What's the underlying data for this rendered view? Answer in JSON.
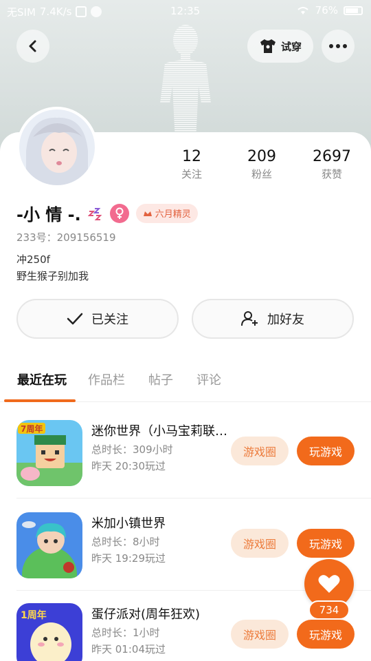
{
  "status_bar": {
    "carrier": "无SIM",
    "speed": "7.4K/s",
    "time": "12:35",
    "battery": "76%"
  },
  "header": {
    "try_on_label": "试穿"
  },
  "profile": {
    "stats": [
      {
        "value": "12",
        "label": "关注"
      },
      {
        "value": "209",
        "label": "粉丝"
      },
      {
        "value": "2697",
        "label": "获赞"
      }
    ],
    "name": "-小 情 -.",
    "badge_label": "六月精灵",
    "id_text": "233号：209156519",
    "bio_lines": [
      "冲250f",
      "野生猴子别加我"
    ]
  },
  "actions": {
    "followed_label": "已关注",
    "add_friend_label": "加好友"
  },
  "tabs": [
    {
      "label": "最近在玩"
    },
    {
      "label": "作品栏"
    },
    {
      "label": "帖子"
    },
    {
      "label": "评论"
    }
  ],
  "games": [
    {
      "title": "迷你世界（小马宝莉联…",
      "duration": "总时长：309小时",
      "last_played": "昨天 20:30玩过",
      "icon_text": "7周年",
      "circle_label": "游戏圈",
      "play_label": "玩游戏"
    },
    {
      "title": "米加小镇世界",
      "duration": "总时长：8小时",
      "last_played": "昨天 19:29玩过",
      "icon_text": "",
      "circle_label": "游戏圈",
      "play_label": "玩游戏"
    },
    {
      "title": "蛋仔派对(周年狂欢)",
      "duration": "总时长：1小时",
      "last_played": "昨天 01:04玩过",
      "icon_text": "1周年",
      "circle_label": "游戏圈",
      "play_label": "玩游戏"
    }
  ],
  "like": {
    "count": "734"
  },
  "colors": {
    "accent": "#f26a1b",
    "badge_bg": "#fde8e4",
    "gender": "#f26b8f"
  }
}
